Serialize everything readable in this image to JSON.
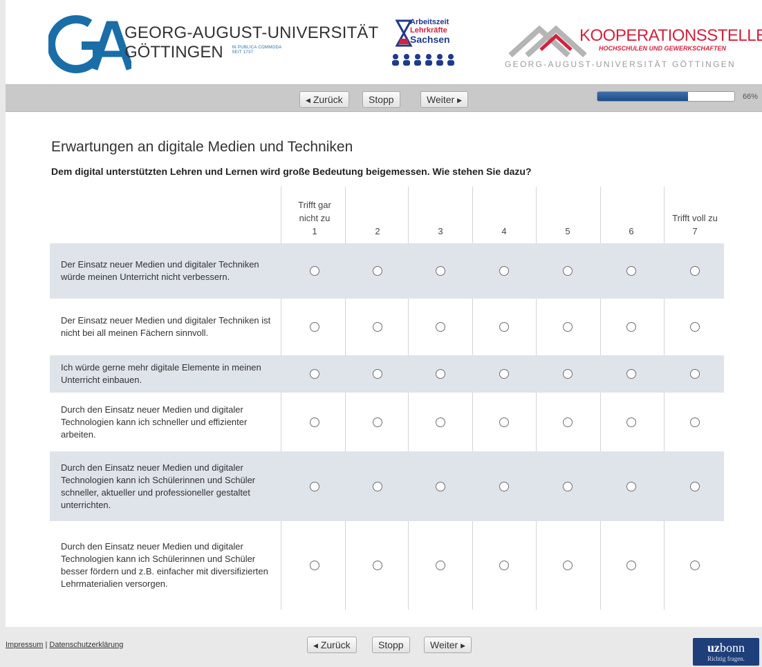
{
  "header": {
    "university_name_line1": "GEORG-AUGUST-UNIVERSITÄT",
    "university_name_line2": "GÖTTINGEN",
    "university_motto_line1": "IN PUBLICA COMMODA",
    "university_motto_line2": "SEIT 1737",
    "az_logo_line1": "Arbeitszeit",
    "az_logo_line2": "Lehrkräfte",
    "az_logo_line3": "Sachsen",
    "ko_title": "KOOPERATIONSSTELLE",
    "ko_subtitle": "HOCHSCHULEN UND GEWERKSCHAFTEN",
    "ko_bottom": "GEORG-AUGUST-UNIVERSITÄT GÖTTINGEN"
  },
  "nav": {
    "back_label": "Zurück",
    "stop_label": "Stopp",
    "next_label": "Weiter",
    "progress_percent": 66,
    "progress_text": "66%"
  },
  "question": {
    "title": "Erwartungen an digitale Medien und Techniken",
    "text": "Dem digital unterstützten Lehren und Lernen wird große Bedeutung beigemessen. Wie stehen Sie dazu?",
    "scale_low_label": "Trifft gar nicht zu",
    "scale_high_label": "Trifft voll zu",
    "columns": [
      "1",
      "2",
      "3",
      "4",
      "5",
      "6",
      "7"
    ],
    "items": [
      "Der Einsatz neuer Medien und digitaler Techniken würde meinen Unterricht nicht verbessern.",
      "Der Einsatz neuer Medien und digitaler Techniken ist nicht bei all meinen Fächern sinnvoll.",
      "Ich würde gerne mehr digitale Elemente in meinen Unterricht einbauen.",
      "Durch den Einsatz neuer Medien und digitaler Technologien kann ich schneller und effizienter arbeiten.",
      "Durch den Einsatz neuer Medien und digitaler Technologien kann ich Schülerinnen und Schüler schneller, aktueller und professioneller gestaltet unterrichten.",
      "Durch den Einsatz neuer Medien und digitaler Technologien kann ich Schülerinnen und Schüler besser fördern und z.B. einfacher mit diversifizierten Lehrmaterialien versorgen."
    ]
  },
  "footer": {
    "impressum": "Impressum",
    "separator": "|",
    "privacy": "Datenschutzerklärung",
    "back_label": "Zurück",
    "stop_label": "Stopp",
    "next_label": "Weiter",
    "logo_main_bold": "uz",
    "logo_main_rest": "bonn",
    "logo_tagline": "Richtig fragen."
  },
  "colors": {
    "row_shade": "#dfe3ea",
    "progress": "#1d4d8a",
    "brand_red": "#d4213d",
    "brand_blue": "#1a6ea8"
  },
  "icons": {
    "back": "triangle-left-icon",
    "next": "triangle-right-icon"
  }
}
